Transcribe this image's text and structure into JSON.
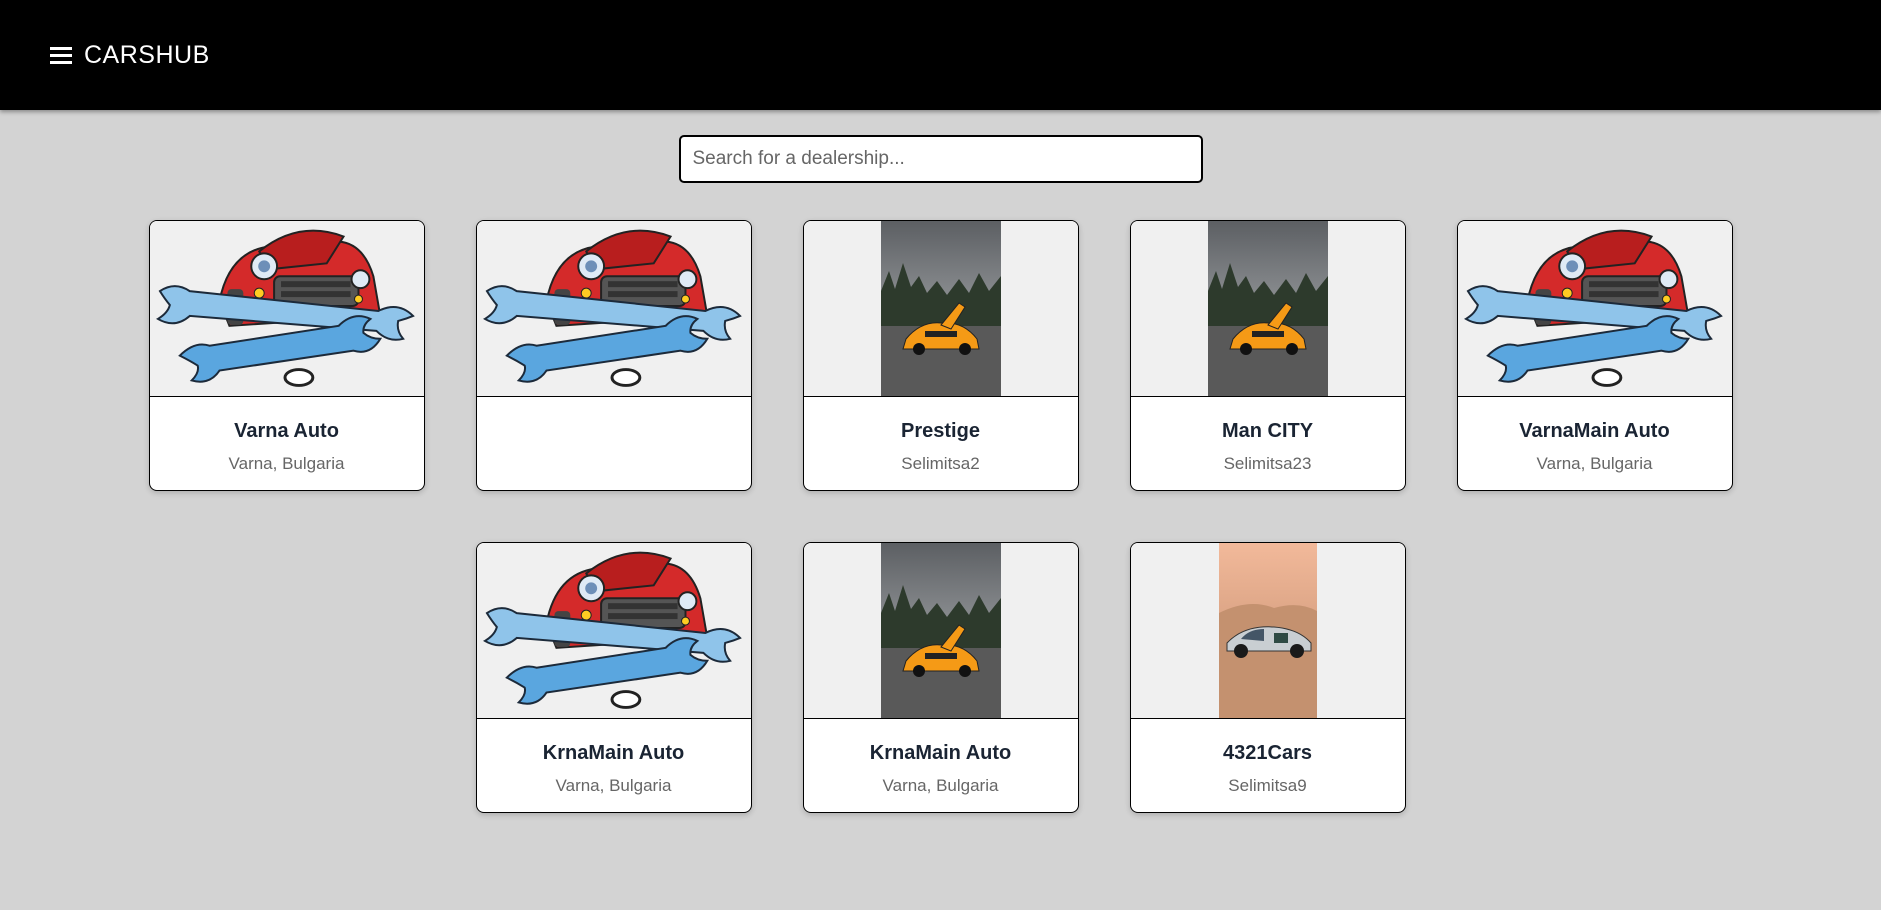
{
  "app": {
    "brand": "CARSHUB",
    "menu_icon": "hamburger-menu-icon"
  },
  "search": {
    "placeholder": "Search for a dealership..."
  },
  "dealerships": [
    {
      "name": "Varna Auto",
      "location": "Varna, Bulgaria",
      "image": "repair-car-logo"
    },
    {
      "name": "",
      "location": "",
      "image": "repair-car-logo"
    },
    {
      "name": "Prestige",
      "location": "Selimitsa2",
      "image": "orange-supercar-photo"
    },
    {
      "name": "Man CITY",
      "location": "Selimitsa23",
      "image": "orange-supercar-photo"
    },
    {
      "name": "VarnaMain Auto",
      "location": "Varna, Bulgaria",
      "image": "repair-car-logo"
    },
    {
      "name": "KrnaMain Auto",
      "location": "Varna, Bulgaria",
      "image": "repair-car-logo"
    },
    {
      "name": "KrnaMain Auto",
      "location": "Varna, Bulgaria",
      "image": "orange-supercar-photo"
    },
    {
      "name": "4321Cars",
      "location": "Selimitsa9",
      "image": "silver-hypercar-photo"
    }
  ]
}
